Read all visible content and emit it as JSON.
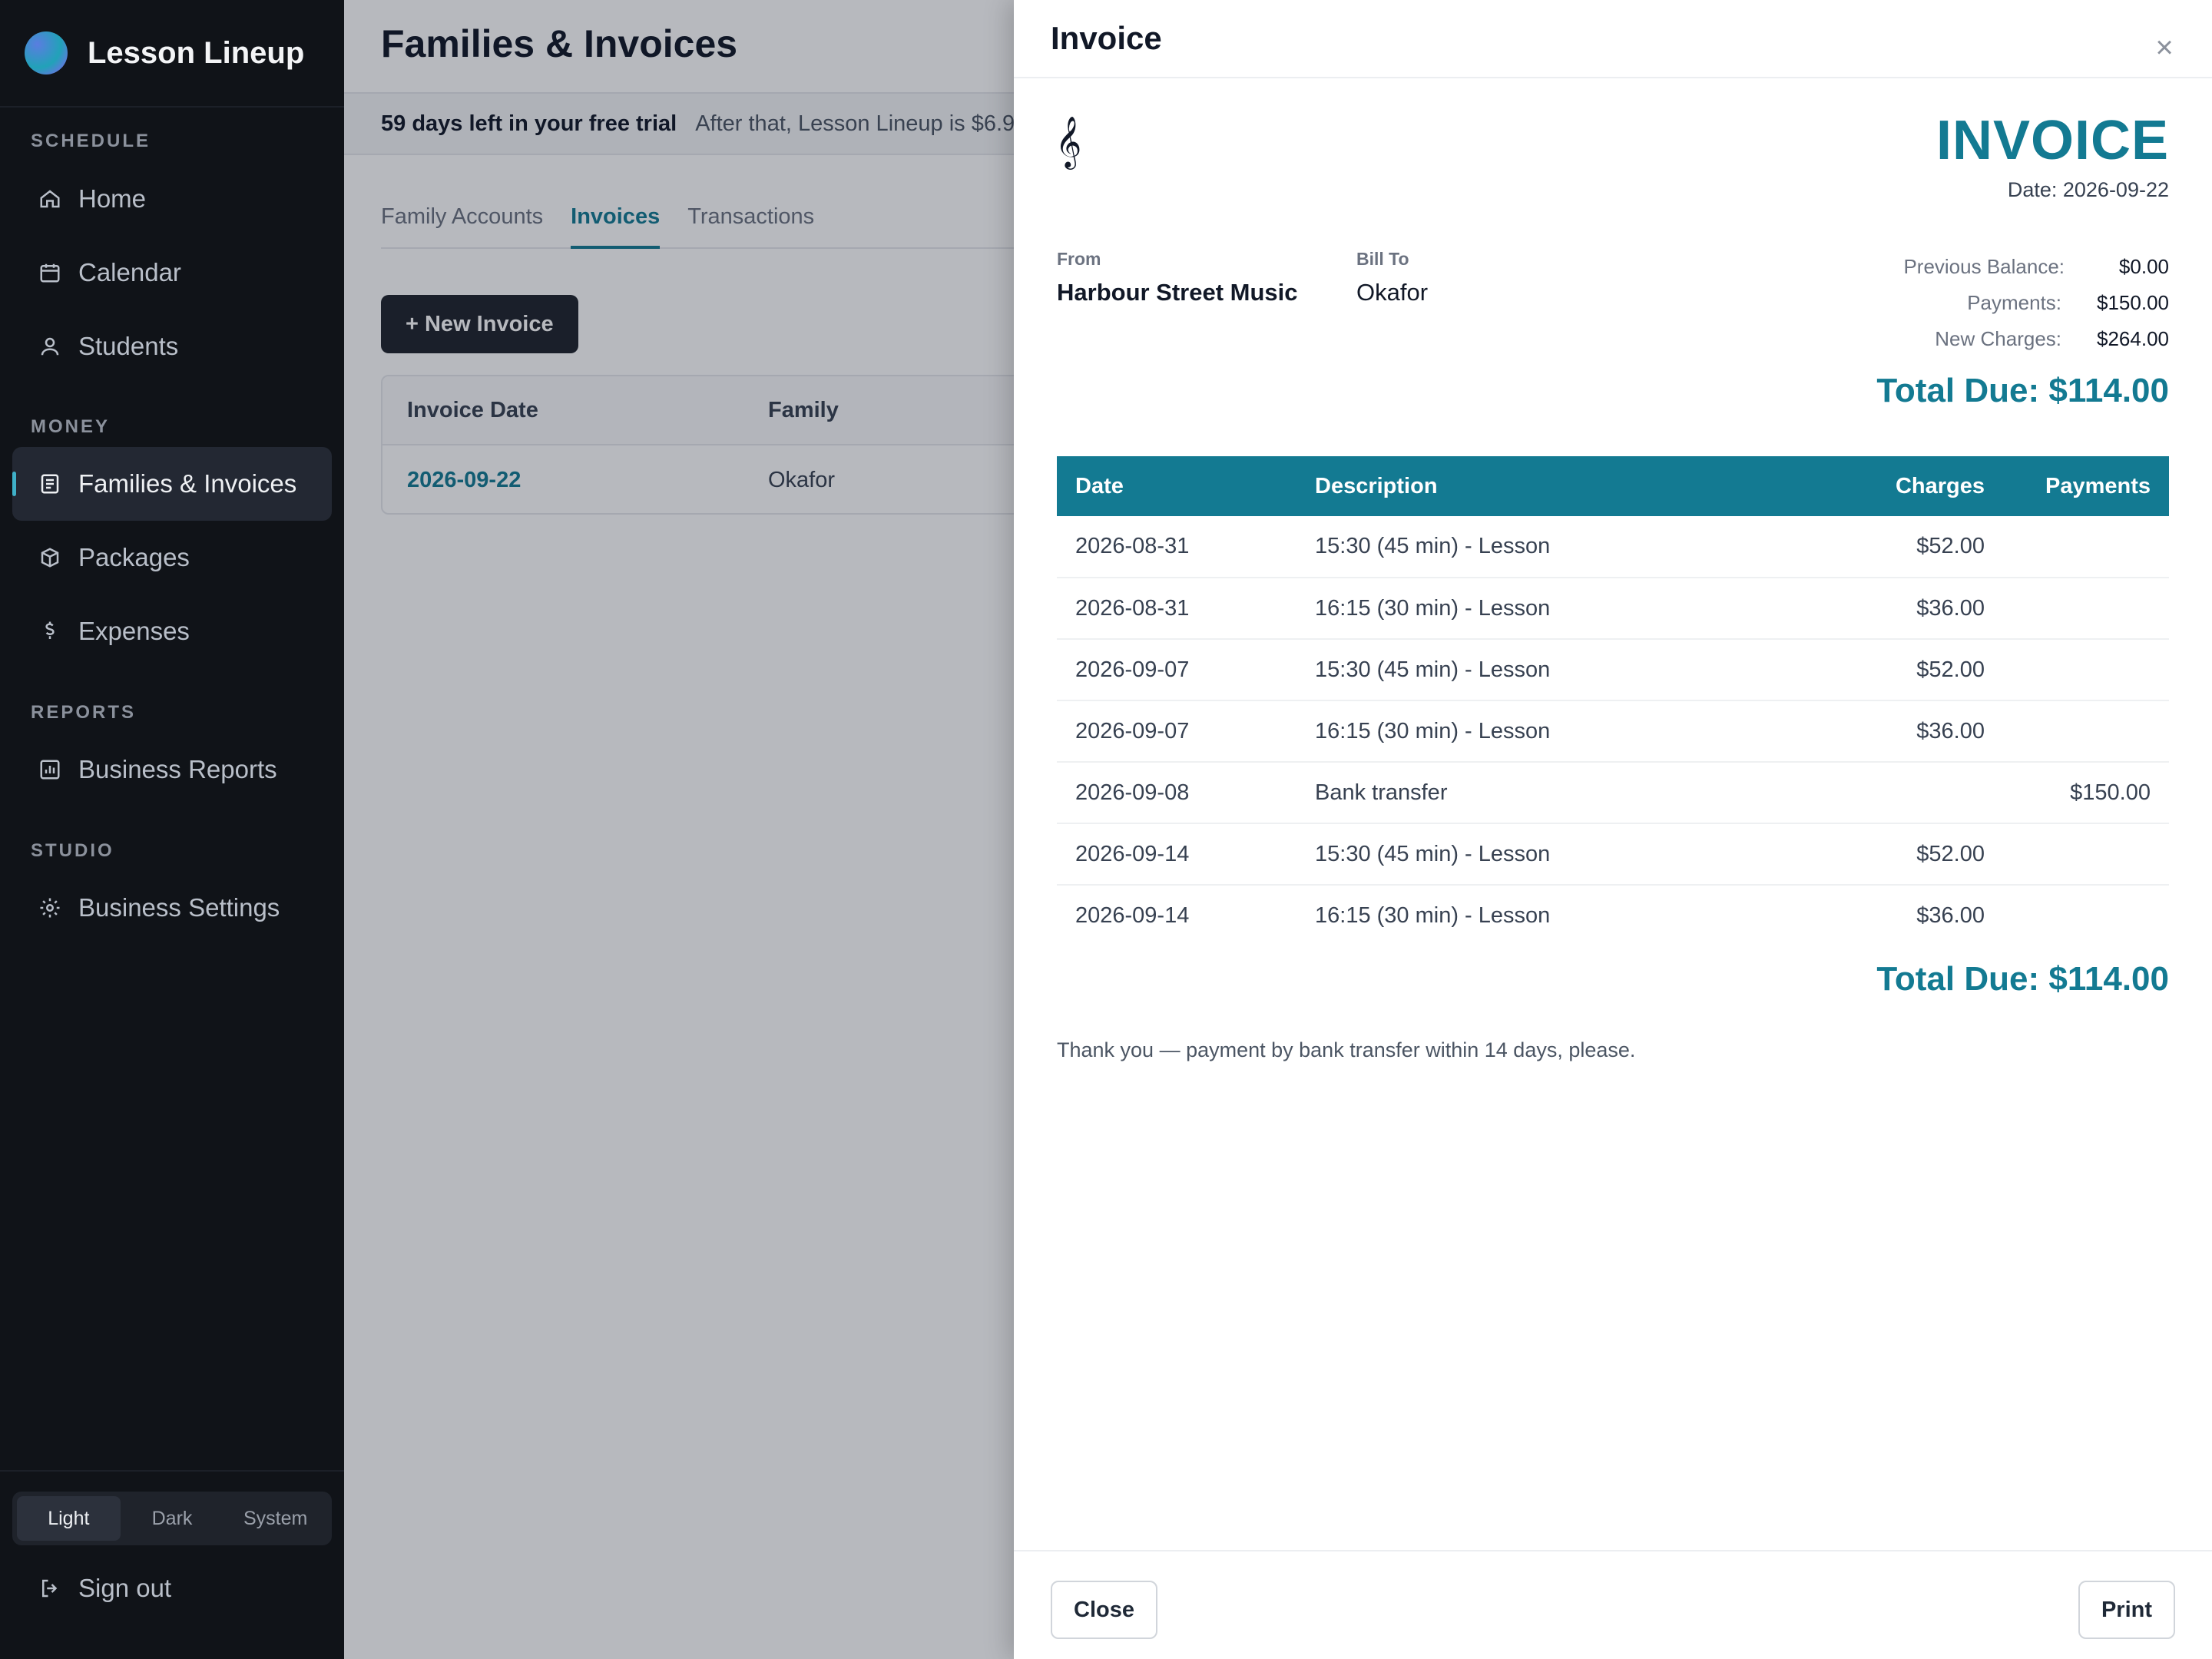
{
  "app": {
    "name": "Lesson Lineup"
  },
  "sidebar": {
    "sections": {
      "schedule": "SCHEDULE",
      "money": "MONEY",
      "reports": "REPORTS",
      "studio": "STUDIO"
    },
    "items": {
      "home": "Home",
      "calendar": "Calendar",
      "students": "Students",
      "families_invoices": "Families & Invoices",
      "packages": "Packages",
      "expenses": "Expenses",
      "business_reports": "Business Reports",
      "business_settings": "Business Settings"
    },
    "theme": {
      "light": "Light",
      "dark": "Dark",
      "system": "System",
      "selected": "Light"
    },
    "sign_out": "Sign out"
  },
  "page": {
    "title": "Families & Invoices",
    "trial": {
      "bold": "59 days left in your free trial",
      "rest": "After that, Lesson Lineup is $6.9"
    },
    "tabs": {
      "family_accounts": "Family Accounts",
      "invoices": "Invoices",
      "transactions": "Transactions"
    },
    "new_invoice_label": "+ New Invoice",
    "table": {
      "headers": {
        "date": "Invoice Date",
        "family": "Family"
      },
      "rows": [
        {
          "date": "2026-09-22",
          "family": "Okafor"
        }
      ]
    }
  },
  "modal": {
    "title": "Invoice",
    "heading": "INVOICE",
    "date_line": "Date: 2026-09-22",
    "from_label": "From",
    "from_value": "Harbour Street Music",
    "billto_label": "Bill To",
    "billto_value": "Okafor",
    "summary": {
      "previous_balance_label": "Previous Balance:",
      "previous_balance_value": "$0.00",
      "payments_label": "Payments:",
      "payments_value": "$150.00",
      "new_charges_label": "New Charges:",
      "new_charges_value": "$264.00"
    },
    "total_due": "Total Due: $114.00",
    "table_headers": {
      "date": "Date",
      "description": "Description",
      "charges": "Charges",
      "payments": "Payments"
    },
    "rows": [
      {
        "date": "2026-08-31",
        "description": "15:30 (45 min) - Lesson",
        "charges": "$52.00",
        "payments": ""
      },
      {
        "date": "2026-08-31",
        "description": "16:15 (30 min) - Lesson",
        "charges": "$36.00",
        "payments": ""
      },
      {
        "date": "2026-09-07",
        "description": "15:30 (45 min) - Lesson",
        "charges": "$52.00",
        "payments": ""
      },
      {
        "date": "2026-09-07",
        "description": "16:15 (30 min) - Lesson",
        "charges": "$36.00",
        "payments": ""
      },
      {
        "date": "2026-09-08",
        "description": "Bank transfer",
        "charges": "",
        "payments": "$150.00"
      },
      {
        "date": "2026-09-14",
        "description": "15:30 (45 min) - Lesson",
        "charges": "$52.00",
        "payments": ""
      },
      {
        "date": "2026-09-14",
        "description": "16:15 (30 min) - Lesson",
        "charges": "$36.00",
        "payments": ""
      }
    ],
    "note": "Thank you — payment by bank transfer within 14 days, please.",
    "close_label": "Close",
    "print_label": "Print"
  },
  "colors": {
    "accent": "#137a92",
    "sidebar_bg": "#101318",
    "dark_button": "#1f232b"
  },
  "icons": {
    "home": "home-icon",
    "calendar": "calendar-icon",
    "students": "user-icon",
    "families": "document-icon",
    "packages": "box-icon",
    "expenses": "dollar-icon",
    "reports": "chart-icon",
    "settings": "gear-icon",
    "signout": "sign-out-icon",
    "close": "close-icon",
    "clef": "treble-clef-icon"
  }
}
